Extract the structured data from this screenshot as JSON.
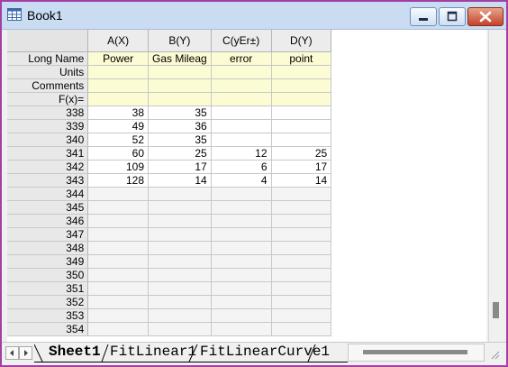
{
  "window": {
    "title": "Book1"
  },
  "columns": [
    {
      "label": "A(X)"
    },
    {
      "label": "B(Y)"
    },
    {
      "label": "C(yEr±)"
    },
    {
      "label": "D(Y)"
    }
  ],
  "meta_rows": [
    {
      "label": "Long Name",
      "values": [
        "Power",
        "Gas Mileag",
        "error",
        "point"
      ]
    },
    {
      "label": "Units",
      "values": [
        "",
        "",
        "",
        ""
      ]
    },
    {
      "label": "Comments",
      "values": [
        "",
        "",
        "",
        ""
      ]
    },
    {
      "label": "F(x)=",
      "values": [
        "",
        "",
        "",
        ""
      ]
    }
  ],
  "rows": [
    {
      "label": "338",
      "values": [
        "38",
        "35",
        "",
        ""
      ]
    },
    {
      "label": "339",
      "values": [
        "49",
        "36",
        "",
        ""
      ]
    },
    {
      "label": "340",
      "values": [
        "52",
        "35",
        "",
        ""
      ]
    },
    {
      "label": "341",
      "values": [
        "60",
        "25",
        "12",
        "25"
      ]
    },
    {
      "label": "342",
      "values": [
        "109",
        "17",
        "6",
        "17"
      ]
    },
    {
      "label": "343",
      "values": [
        "128",
        "14",
        "4",
        "14"
      ]
    },
    {
      "label": "344",
      "values": [
        "",
        "",
        "",
        ""
      ]
    },
    {
      "label": "345",
      "values": [
        "",
        "",
        "",
        ""
      ]
    },
    {
      "label": "346",
      "values": [
        "",
        "",
        "",
        ""
      ]
    },
    {
      "label": "347",
      "values": [
        "",
        "",
        "",
        ""
      ]
    },
    {
      "label": "348",
      "values": [
        "",
        "",
        "",
        ""
      ]
    },
    {
      "label": "349",
      "values": [
        "",
        "",
        "",
        ""
      ]
    },
    {
      "label": "350",
      "values": [
        "",
        "",
        "",
        ""
      ]
    },
    {
      "label": "351",
      "values": [
        "",
        "",
        "",
        ""
      ]
    },
    {
      "label": "352",
      "values": [
        "",
        "",
        "",
        ""
      ]
    },
    {
      "label": "353",
      "values": [
        "",
        "",
        "",
        ""
      ]
    },
    {
      "label": "354",
      "values": [
        "",
        "",
        "",
        ""
      ]
    }
  ],
  "sheet_tabs": [
    {
      "label": "Sheet1",
      "active": true
    },
    {
      "label": "FitLinear1",
      "active": false
    },
    {
      "label": "FitLinearCurve1",
      "active": false
    }
  ],
  "icons": {
    "app": "worksheet-icon",
    "minimize": "minimize-icon",
    "maximize": "maximize-icon",
    "close": "close-icon",
    "tab_prev": "chevron-left-icon",
    "tab_next": "chevron-right-icon"
  },
  "colors": {
    "window_border": "#a33fa3",
    "titlebar": "#c9dcf2",
    "meta_row_bg": "#fbfbd4",
    "close_button": "#c5432a"
  }
}
